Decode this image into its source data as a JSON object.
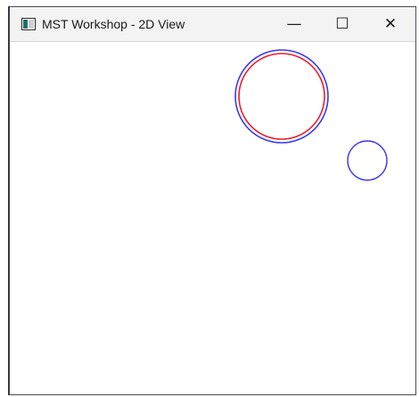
{
  "window": {
    "title": "MST Workshop - 2D View",
    "icon": "app-window-icon"
  },
  "caption_buttons": {
    "minimize": {
      "icon": "minimize-icon",
      "glyph": "—"
    },
    "maximize": {
      "icon": "maximize-icon",
      "glyph": "☐"
    },
    "close": {
      "icon": "close-icon",
      "glyph": "✕"
    }
  },
  "colors": {
    "circle_blue": "#3a3af0",
    "circle_red": "#e8202a"
  }
}
